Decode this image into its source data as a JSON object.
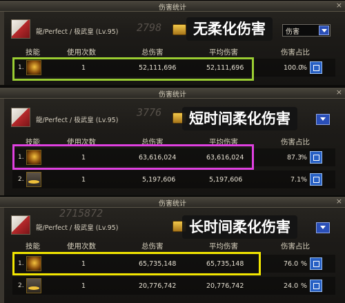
{
  "window_title": "伤害统计",
  "close_glyph": "×",
  "player": "龍/Perfect / 极武皇 (Lv.95)",
  "headers": [
    "技能",
    "使用次数",
    "总伤害",
    "平均伤害",
    "伤害占比"
  ],
  "panels": [
    {
      "overlay_label": "无柔化伤害",
      "dropdown_value": "伤害",
      "ghost_text": "2798",
      "highlight_color": "#9acd32",
      "rows": [
        {
          "rank": "1.",
          "count": "1",
          "total": "52,111,696",
          "avg": "52,111,696",
          "pct": "100.0",
          "pct_unit": "%"
        }
      ]
    },
    {
      "overlay_label": "短时间柔化伤害",
      "ghost_text": "3776",
      "highlight_color": "#e040e0",
      "rows": [
        {
          "rank": "1.",
          "count": "1",
          "total": "63,616,024",
          "avg": "63,616,024",
          "pct": "87.3",
          "pct_unit": "%"
        },
        {
          "rank": "2.",
          "count": "1",
          "total": "5,197,606",
          "avg": "5,197,606",
          "pct": "7.1",
          "pct_unit": "%"
        }
      ]
    },
    {
      "overlay_label": "长时间柔化伤害",
      "ghost_text": "2715872",
      "highlight_color": "#f2e600",
      "rows": [
        {
          "rank": "1.",
          "count": "1",
          "total": "65,735,148",
          "avg": "65,735,148",
          "pct": "76.0",
          "pct_unit": "%"
        },
        {
          "rank": "2.",
          "count": "1",
          "total": "20,776,742",
          "avg": "20,776,742",
          "pct": "24.0",
          "pct_unit": "%"
        }
      ]
    }
  ]
}
